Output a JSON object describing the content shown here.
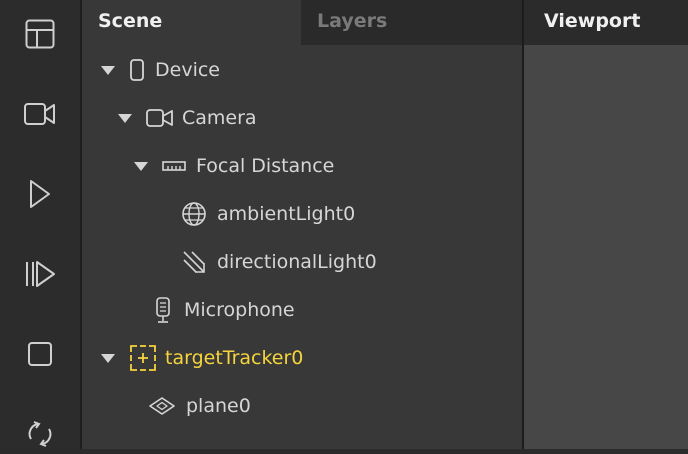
{
  "toolbar": {
    "items": [
      {
        "icon": "layout-icon"
      },
      {
        "icon": "video-camera-icon"
      },
      {
        "icon": "play-icon"
      },
      {
        "icon": "step-forward-icon"
      },
      {
        "icon": "stop-icon"
      },
      {
        "icon": "refresh-icon"
      }
    ]
  },
  "tabs": {
    "scene": "Scene",
    "layers": "Layers"
  },
  "viewport": {
    "title": "Viewport"
  },
  "tree": [
    {
      "label": "Device",
      "icon": "phone-icon",
      "expanded": true
    },
    {
      "label": "Camera",
      "icon": "camera-icon",
      "expanded": true
    },
    {
      "label": "Focal Distance",
      "icon": "ruler-icon",
      "expanded": true
    },
    {
      "label": "ambientLight0",
      "icon": "globe-icon"
    },
    {
      "label": "directionalLight0",
      "icon": "directional-light-icon"
    },
    {
      "label": "Microphone",
      "icon": "microphone-icon"
    },
    {
      "label": "targetTracker0",
      "icon": "target-tracker-icon",
      "expanded": true,
      "color": "#f5d43c"
    },
    {
      "label": "plane0",
      "icon": "plane-icon"
    }
  ]
}
